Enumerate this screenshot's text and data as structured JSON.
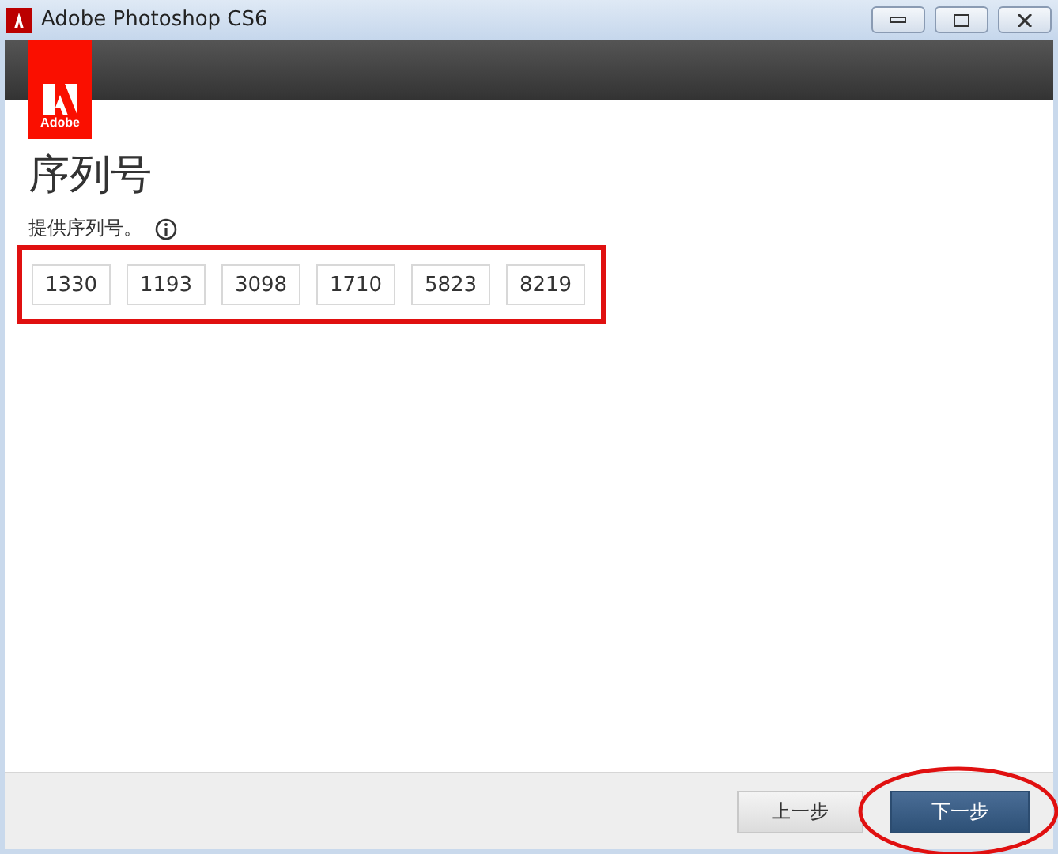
{
  "window": {
    "title": "Adobe Photoshop CS6"
  },
  "logo": {
    "text": "Adobe"
  },
  "heading": "序列号",
  "prompt": "提供序列号。",
  "serial_fields": [
    {
      "value": "1330"
    },
    {
      "value": "1193"
    },
    {
      "value": "3098"
    },
    {
      "value": "1710"
    },
    {
      "value": "5823"
    },
    {
      "value": "8219"
    }
  ],
  "buttons": [
    {
      "label": "上一步",
      "kind": "secondary"
    },
    {
      "label": "下一步",
      "kind": "primary"
    }
  ]
}
